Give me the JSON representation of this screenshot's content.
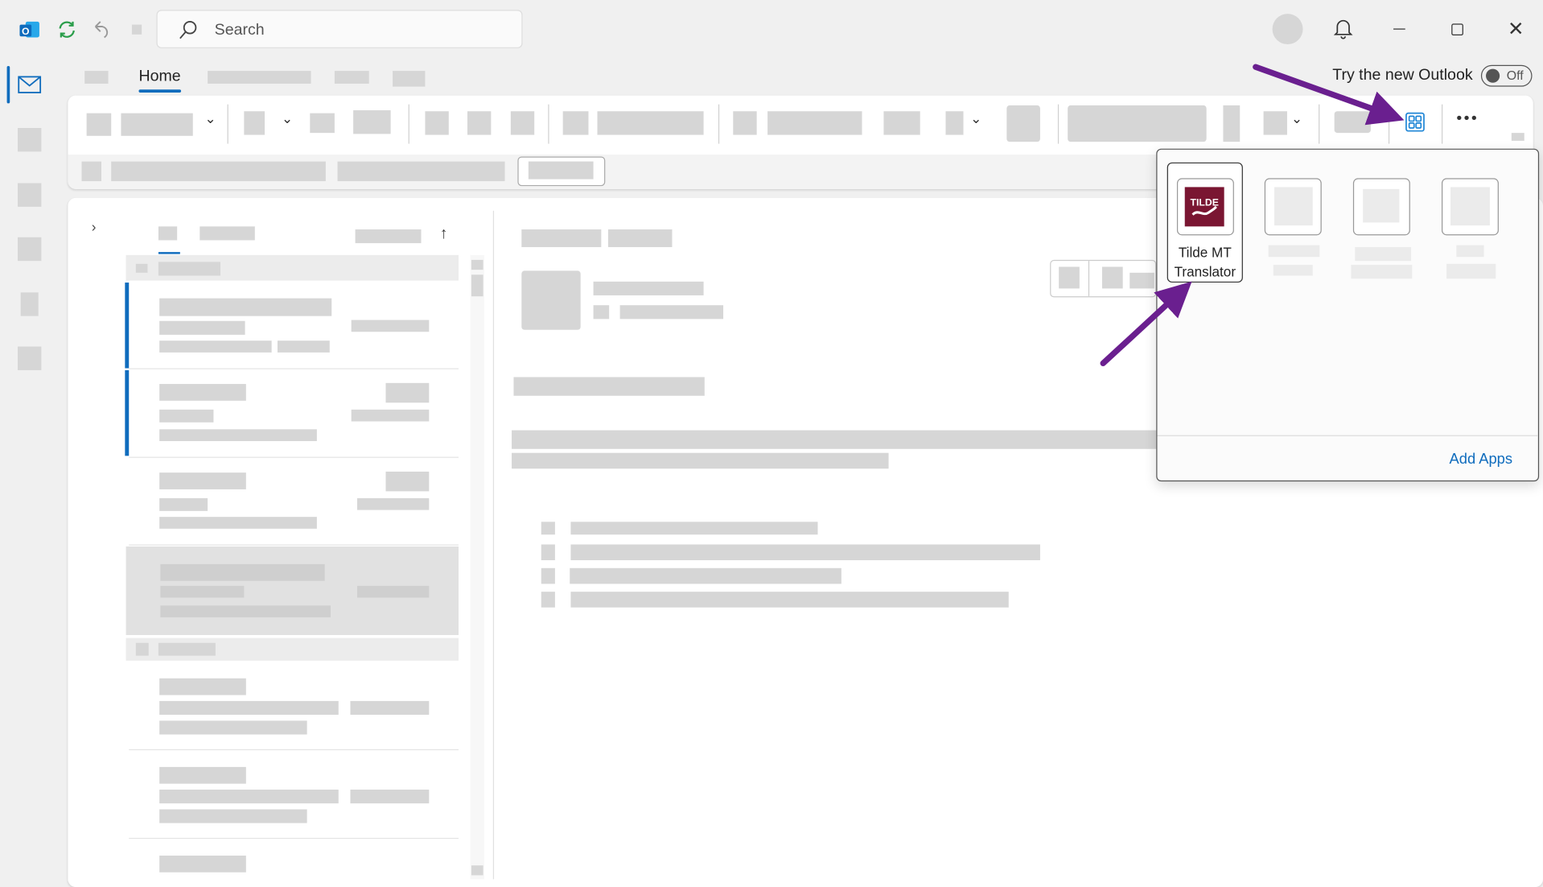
{
  "titlebar": {
    "search_placeholder": "Search",
    "icons": [
      "outlook-logo-icon",
      "sync-icon",
      "undo-icon",
      "user-avatar",
      "bell-icon",
      "minimize-icon",
      "restore-icon",
      "close-icon"
    ]
  },
  "tabs": {
    "active": "Home"
  },
  "new_outlook": {
    "label": "Try the new Outlook",
    "toggle_state": "Off"
  },
  "apps_popup": {
    "apps": [
      {
        "name": "Tilde MT Translator",
        "line1": "Tilde MT",
        "line2": "Translator",
        "logo_text": "TILDE",
        "logo_color": "#7a1632"
      }
    ],
    "add_apps_label": "Add Apps"
  },
  "colors": {
    "accent": "#0f6cbd",
    "annotation_arrow": "#6a1f8f",
    "apps_icon": "#1f86d6"
  }
}
